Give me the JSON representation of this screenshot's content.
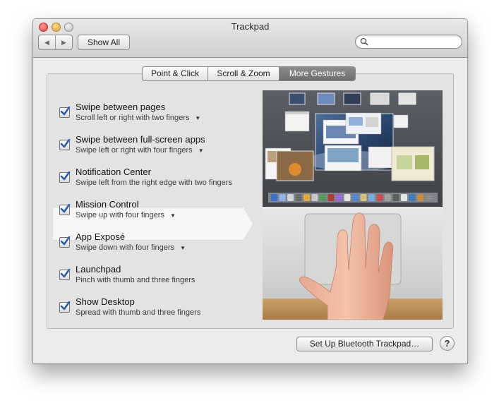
{
  "window": {
    "title": "Trackpad"
  },
  "toolbar": {
    "back_glyph": "◀",
    "forward_glyph": "▶",
    "show_all_label": "Show All",
    "search_value": "",
    "search_placeholder": ""
  },
  "tabs": [
    {
      "label": "Point & Click",
      "active": false
    },
    {
      "label": "Scroll & Zoom",
      "active": false
    },
    {
      "label": "More Gestures",
      "active": true
    }
  ],
  "gestures": [
    {
      "title": "Swipe between pages",
      "subtitle": "Scroll left or right with two fingers",
      "checked": true,
      "has_menu": true,
      "selected": false
    },
    {
      "title": "Swipe between full-screen apps",
      "subtitle": "Swipe left or right with four fingers",
      "checked": true,
      "has_menu": true,
      "selected": false
    },
    {
      "title": "Notification Center",
      "subtitle": "Swipe left from the right edge with two fingers",
      "checked": true,
      "has_menu": false,
      "selected": false
    },
    {
      "title": "Mission Control",
      "subtitle": "Swipe up with four fingers",
      "checked": true,
      "has_menu": true,
      "selected": true
    },
    {
      "title": "App Exposé",
      "subtitle": "Swipe down with four fingers",
      "checked": true,
      "has_menu": true,
      "selected": false
    },
    {
      "title": "Launchpad",
      "subtitle": "Pinch with thumb and three fingers",
      "checked": true,
      "has_menu": false,
      "selected": false
    },
    {
      "title": "Show Desktop",
      "subtitle": "Spread with thumb and three fingers",
      "checked": true,
      "has_menu": false,
      "selected": false
    }
  ],
  "footer": {
    "setup_bluetooth_label": "Set Up Bluetooth Trackpad…",
    "help_label": "?"
  },
  "colors": {
    "check_blue": "#2a5fb0",
    "active_tab": "#7a7a7a",
    "desktop_blue": "#2f4f74"
  }
}
